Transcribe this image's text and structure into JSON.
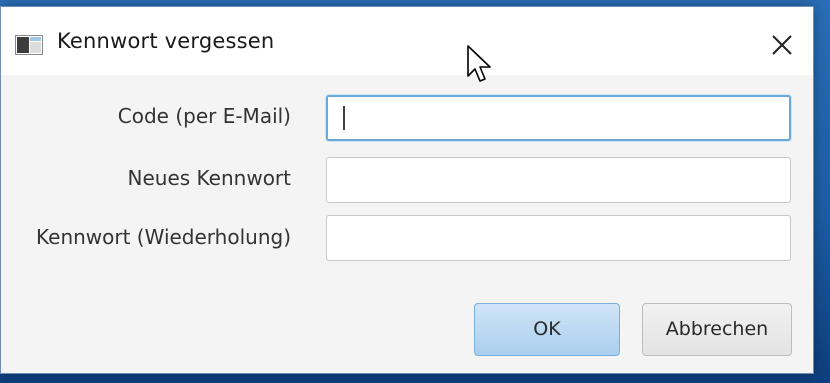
{
  "window": {
    "title": "Kennwort vergessen",
    "close_icon": "close-icon",
    "app_icon": "app-window-icon"
  },
  "form": {
    "code_label": "Code (per E-Mail)",
    "code_value": "",
    "new_password_label": "Neues Kennwort",
    "new_password_value": "",
    "repeat_password_label": "Kennwort (Wiederholung)",
    "repeat_password_value": ""
  },
  "buttons": {
    "ok_label": "OK",
    "cancel_label": "Abbrechen"
  },
  "colors": {
    "focus_border": "#6aa9d8",
    "ok_button": "#aacfee",
    "desktop": "#1c5ea6"
  }
}
